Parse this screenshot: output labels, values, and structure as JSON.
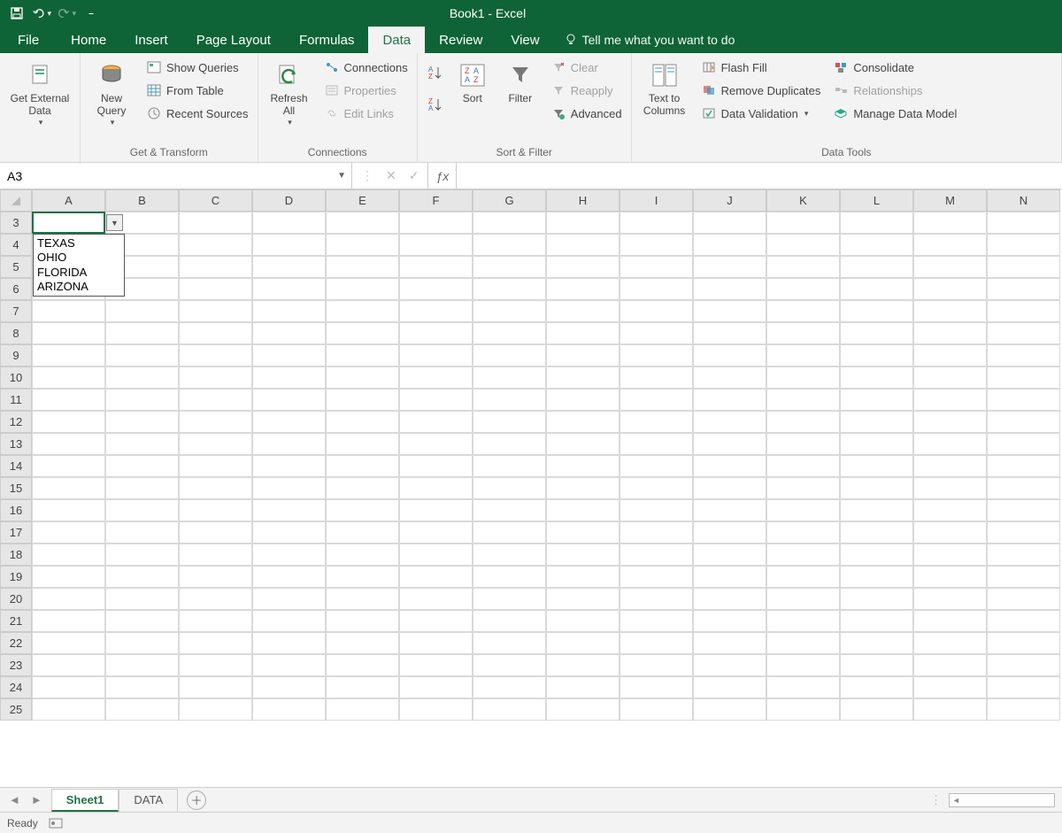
{
  "title": "Book1  -  Excel",
  "qat": {
    "save": "save",
    "undo": "undo",
    "redo": "redo"
  },
  "tabs": {
    "file": "File",
    "home": "Home",
    "insert": "Insert",
    "page_layout": "Page Layout",
    "formulas": "Formulas",
    "data": "Data",
    "review": "Review",
    "view": "View",
    "tell_me": "Tell me what you want to do"
  },
  "ribbon": {
    "get_external": "Get External\nData",
    "new_query": "New\nQuery",
    "show_queries": "Show Queries",
    "from_table": "From Table",
    "recent_sources": "Recent Sources",
    "group_get_transform": "Get & Transform",
    "refresh_all": "Refresh\nAll",
    "connections": "Connections",
    "properties": "Properties",
    "edit_links": "Edit Links",
    "group_connections": "Connections",
    "sort": "Sort",
    "filter": "Filter",
    "clear": "Clear",
    "reapply": "Reapply",
    "advanced": "Advanced",
    "group_sort_filter": "Sort & Filter",
    "text_to_columns": "Text to\nColumns",
    "flash_fill": "Flash Fill",
    "remove_dup": "Remove Duplicates",
    "data_validation": "Data Validation",
    "consolidate": "Consolidate",
    "relationships": "Relationships",
    "manage_dm": "Manage Data Model",
    "group_data_tools": "Data Tools"
  },
  "name_box": "A3",
  "formula": "",
  "columns": [
    "A",
    "B",
    "C",
    "D",
    "E",
    "F",
    "G",
    "H",
    "I",
    "J",
    "K",
    "L",
    "M",
    "N"
  ],
  "rows_start": 3,
  "rows_end": 25,
  "selected_cell": "A3",
  "dropdown_items": [
    "TEXAS",
    "OHIO",
    "FLORIDA",
    "ARIZONA"
  ],
  "sheet_tabs": [
    {
      "name": "Sheet1",
      "active": true
    },
    {
      "name": "DATA",
      "active": false
    }
  ],
  "status": "Ready"
}
